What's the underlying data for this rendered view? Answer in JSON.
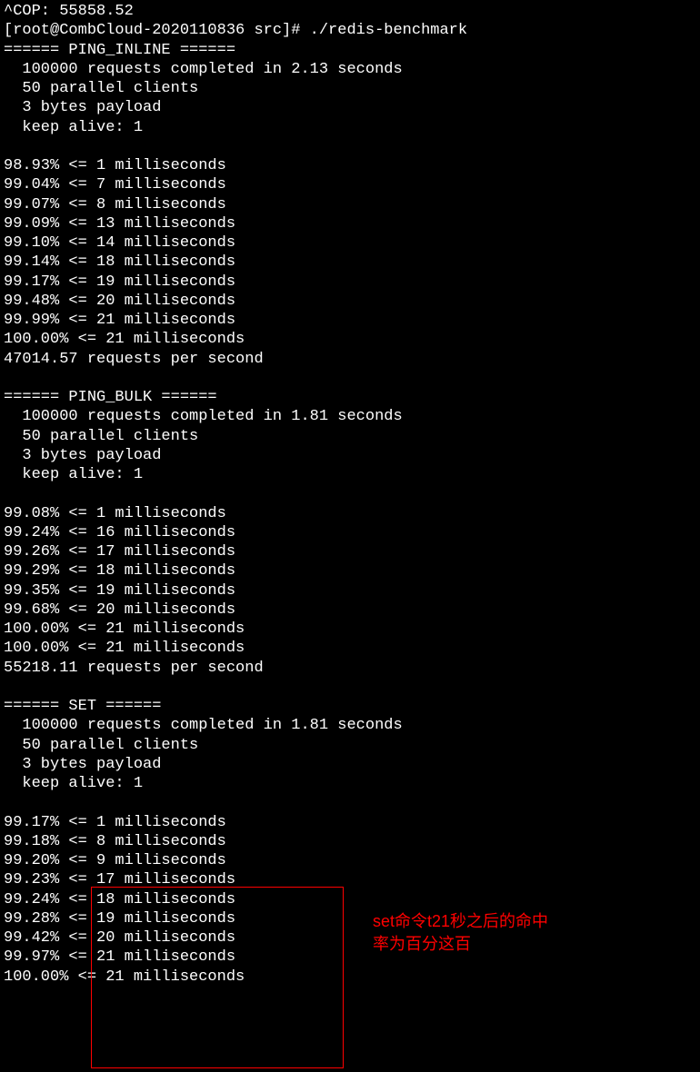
{
  "terminal": {
    "line0": "^COP: 55858.52",
    "prompt": "[root@CombCloud-2020110836 src]# ./redis-benchmark",
    "ping_inline": {
      "header": "====== PING_INLINE ======",
      "requests": "  100000 requests completed in 2.13 seconds",
      "clients": "  50 parallel clients",
      "payload": "  3 bytes payload",
      "keepalive": "  keep alive: 1",
      "latencies": [
        "98.93% <= 1 milliseconds",
        "99.04% <= 7 milliseconds",
        "99.07% <= 8 milliseconds",
        "99.09% <= 13 milliseconds",
        "99.10% <= 14 milliseconds",
        "99.14% <= 18 milliseconds",
        "99.17% <= 19 milliseconds",
        "99.48% <= 20 milliseconds",
        "99.99% <= 21 milliseconds",
        "100.00% <= 21 milliseconds"
      ],
      "rps": "47014.57 requests per second"
    },
    "ping_bulk": {
      "header": "====== PING_BULK ======",
      "requests": "  100000 requests completed in 1.81 seconds",
      "clients": "  50 parallel clients",
      "payload": "  3 bytes payload",
      "keepalive": "  keep alive: 1",
      "latencies": [
        "99.08% <= 1 milliseconds",
        "99.24% <= 16 milliseconds",
        "99.26% <= 17 milliseconds",
        "99.29% <= 18 milliseconds",
        "99.35% <= 19 milliseconds",
        "99.68% <= 20 milliseconds",
        "100.00% <= 21 milliseconds",
        "100.00% <= 21 milliseconds"
      ],
      "rps": "55218.11 requests per second"
    },
    "set": {
      "header": "====== SET ======",
      "requests": "  100000 requests completed in 1.81 seconds",
      "clients": "  50 parallel clients",
      "payload": "  3 bytes payload",
      "keepalive": "  keep alive: 1",
      "latencies": [
        "99.17% <= 1 milliseconds",
        "99.18% <= 8 milliseconds",
        "99.20% <= 9 milliseconds",
        "99.23% <= 17 milliseconds",
        "99.24% <= 18 milliseconds",
        "99.28% <= 19 milliseconds",
        "99.42% <= 20 milliseconds",
        "99.97% <= 21 milliseconds",
        "100.00% <= 21 milliseconds"
      ]
    }
  },
  "annotation": {
    "line1": "set命令t21秒之后的命中",
    "line2": "率为百分这百"
  }
}
